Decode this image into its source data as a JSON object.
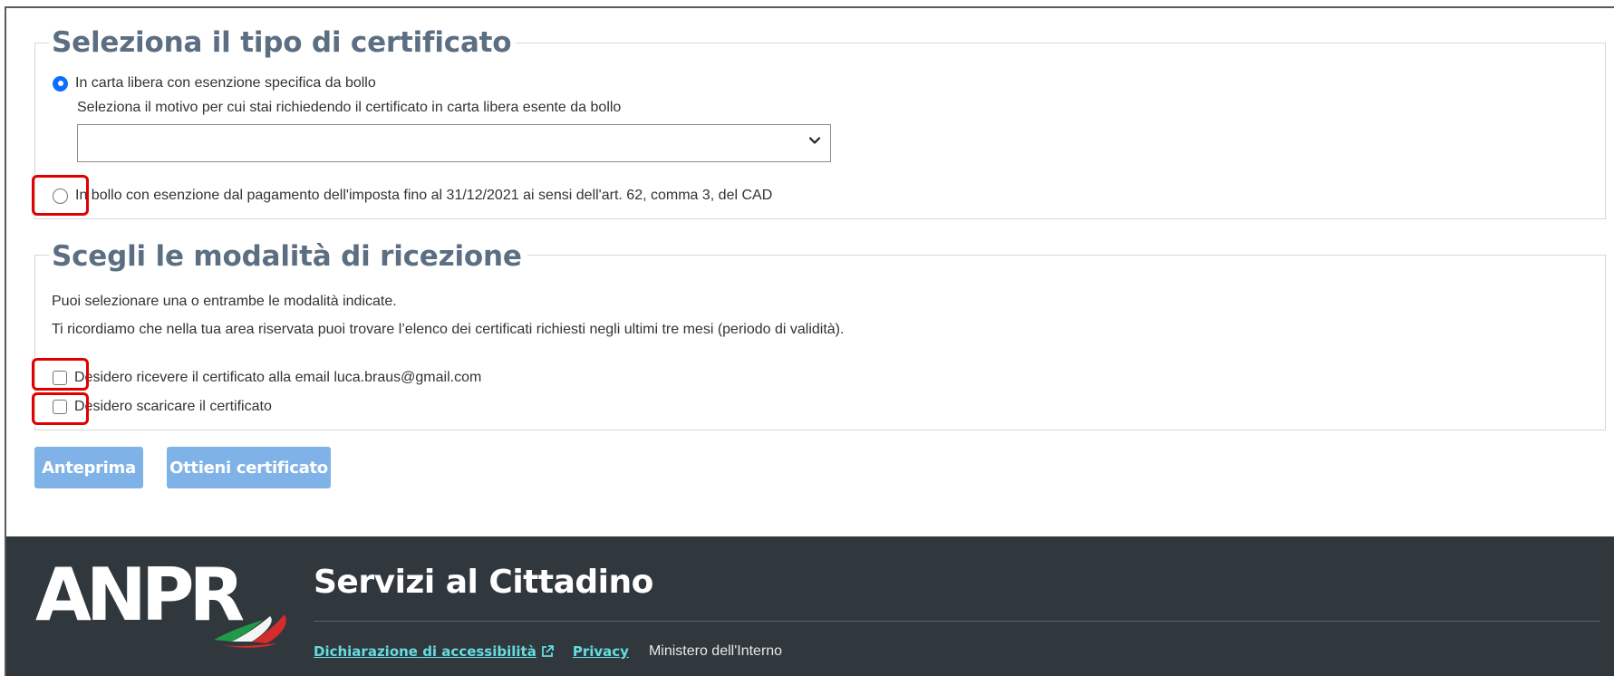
{
  "certificate_type": {
    "legend": "Seleziona il tipo di certificato",
    "option_free_label": "In carta libera con esenzione specifica da bollo",
    "option_free_hint": "Seleziona il motivo per cui stai richiedendo il certificato in carta libera esente da bollo",
    "select_value": "",
    "option_bollo_label": "In bollo con esenzione dal pagamento dell'imposta fino al 31/12/2021 ai sensi dell'art. 62, comma 3, del CAD"
  },
  "delivery": {
    "legend": "Scegli le modalità di ricezione",
    "intro_1": "Puoi selezionare una o entrambe le modalità indicate.",
    "intro_2": "Ti ricordiamo che nella tua area riservata puoi trovare l’elenco dei certificati richiesti negli ultimi tre mesi (periodo di validità).",
    "email_label": "Desidero ricevere il certificato alla email luca.braus@gmail.com",
    "download_label": "Desidero scaricare il certificato"
  },
  "actions": {
    "preview_label": "Anteprima",
    "get_label": "Ottieni certificato"
  },
  "footer": {
    "logo_text": "ANPR",
    "title": "Servizi al Cittadino",
    "accessibility_link": "Dichiarazione di accessibilità",
    "privacy_link": "Privacy",
    "ministry": "Ministero dell'Interno"
  },
  "colors": {
    "accent": "#0d6efd",
    "legend": "#5c6f82",
    "button": "#7fb3e8",
    "footer_bg": "#30373d",
    "footer_link": "#65dcdf",
    "highlight": "#e00000"
  },
  "icons": {
    "select_caret": "chevron-down-icon",
    "external_link": "external-link-icon"
  }
}
